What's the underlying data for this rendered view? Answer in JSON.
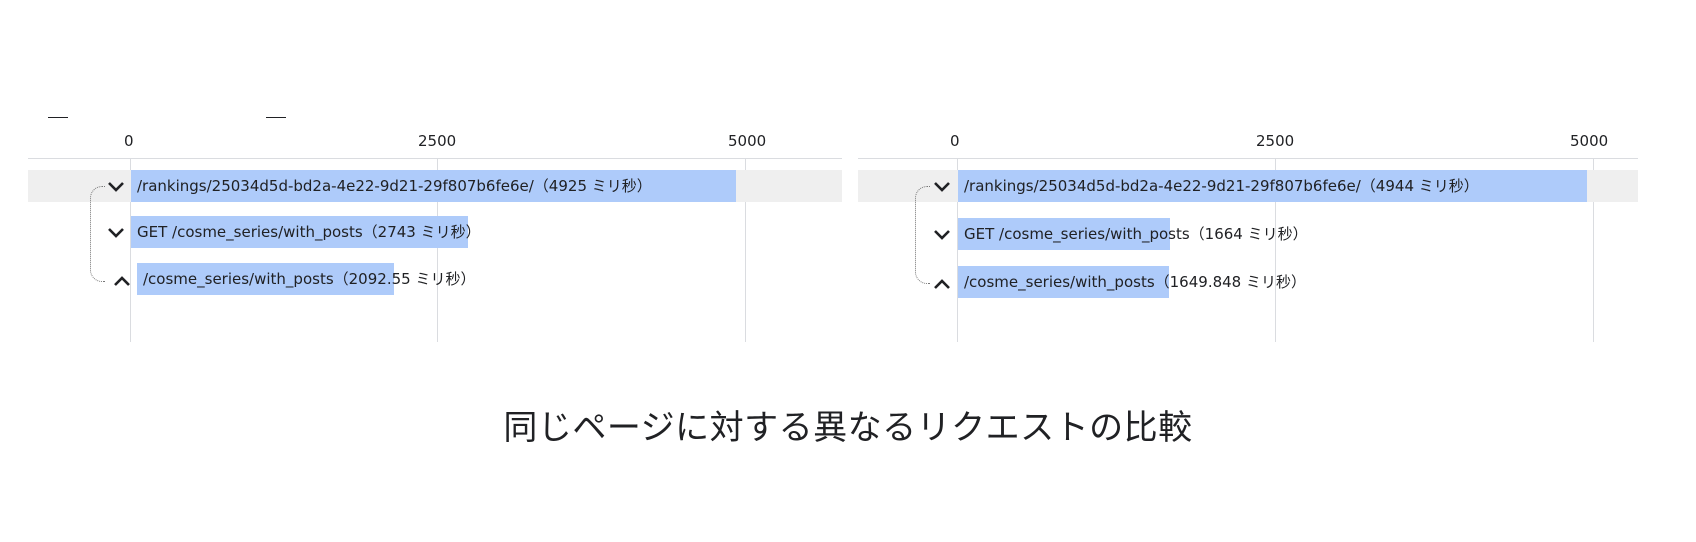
{
  "caption": "同じページに対する異なるリクエストの比較",
  "panels": [
    {
      "ticks": [
        "0",
        "2500",
        "5000"
      ],
      "rows": [
        {
          "label": "/rankings/25034d5d-bd2a-4e22-9d21-29f807b6fe6e/（4925 ミリ秒）",
          "duration_ms": 4925,
          "chevron": "chevron-down-icon"
        },
        {
          "label": "GET /cosme_series/with_posts（2743 ミリ秒）",
          "duration_ms": 2743,
          "chevron": "chevron-down-icon"
        },
        {
          "label": "/cosme_series/with_posts（2092.55 ミリ秒）",
          "duration_ms": 2092.55,
          "chevron": "chevron-up-icon"
        }
      ]
    },
    {
      "ticks": [
        "0",
        "2500",
        "5000"
      ],
      "rows": [
        {
          "label": "/rankings/25034d5d-bd2a-4e22-9d21-29f807b6fe6e/（4944 ミリ秒）",
          "duration_ms": 4944,
          "chevron": "chevron-down-icon"
        },
        {
          "label": "GET /cosme_series/with_posts（1664 ミリ秒）",
          "duration_ms": 1664,
          "chevron": "chevron-down-icon"
        },
        {
          "label": "/cosme_series/with_posts（1649.848 ミリ秒）",
          "duration_ms": 1649.848,
          "chevron": "chevron-up-icon"
        }
      ]
    }
  ]
}
